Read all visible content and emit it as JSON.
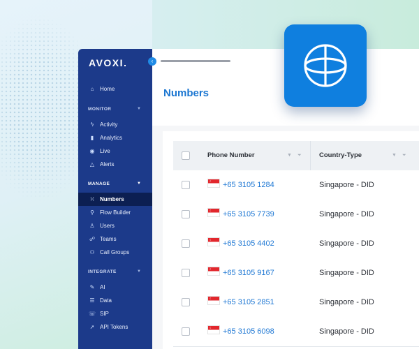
{
  "brand": {
    "name": "AVOXI"
  },
  "sidebar": {
    "home": {
      "label": "Home",
      "icon": "home-icon"
    },
    "sections": {
      "monitor": {
        "title": "MONITOR",
        "items": [
          {
            "label": "Activity",
            "icon": "bolt-icon"
          },
          {
            "label": "Analytics",
            "icon": "bar-chart-icon"
          },
          {
            "label": "Live",
            "icon": "live-icon"
          },
          {
            "label": "Alerts",
            "icon": "warning-icon"
          }
        ]
      },
      "manage": {
        "title": "MANAGE",
        "items": [
          {
            "label": "Numbers",
            "icon": "dialpad-icon",
            "active": true
          },
          {
            "label": "Flow Builder",
            "icon": "flow-icon"
          },
          {
            "label": "Users",
            "icon": "user-icon"
          },
          {
            "label": "Teams",
            "icon": "team-icon"
          },
          {
            "label": "Call Groups",
            "icon": "call-group-icon"
          }
        ]
      },
      "integrate": {
        "title": "INTEGRATE",
        "items": [
          {
            "label": "AI",
            "icon": "sparkle-icon"
          },
          {
            "label": "Data",
            "icon": "database-icon"
          },
          {
            "label": "SIP",
            "icon": "sip-icon"
          },
          {
            "label": "API Tokens",
            "icon": "rocket-icon"
          }
        ]
      }
    }
  },
  "main": {
    "title": "Numbers",
    "table": {
      "columns": [
        "Phone Number",
        "Country-Type"
      ],
      "rows": [
        {
          "phone": "+65 3105 1284",
          "country": "Singapore - DID"
        },
        {
          "phone": "+65 3105 7739",
          "country": "Singapore - DID"
        },
        {
          "phone": "+65 3105 4402",
          "country": "Singapore - DID"
        },
        {
          "phone": "+65 3105 9167",
          "country": "Singapore - DID"
        },
        {
          "phone": "+65 3105 2851",
          "country": "Singapore - DID"
        },
        {
          "phone": "+65 3105 6098",
          "country": "Singapore - DID"
        }
      ]
    }
  },
  "colors": {
    "sidebar": "#1c3a8a",
    "sidebar_active": "#0c1f52",
    "accent": "#1b76d1",
    "globe_tile": "#0f7fdf"
  },
  "globe": {
    "icon": "globe-icon"
  }
}
